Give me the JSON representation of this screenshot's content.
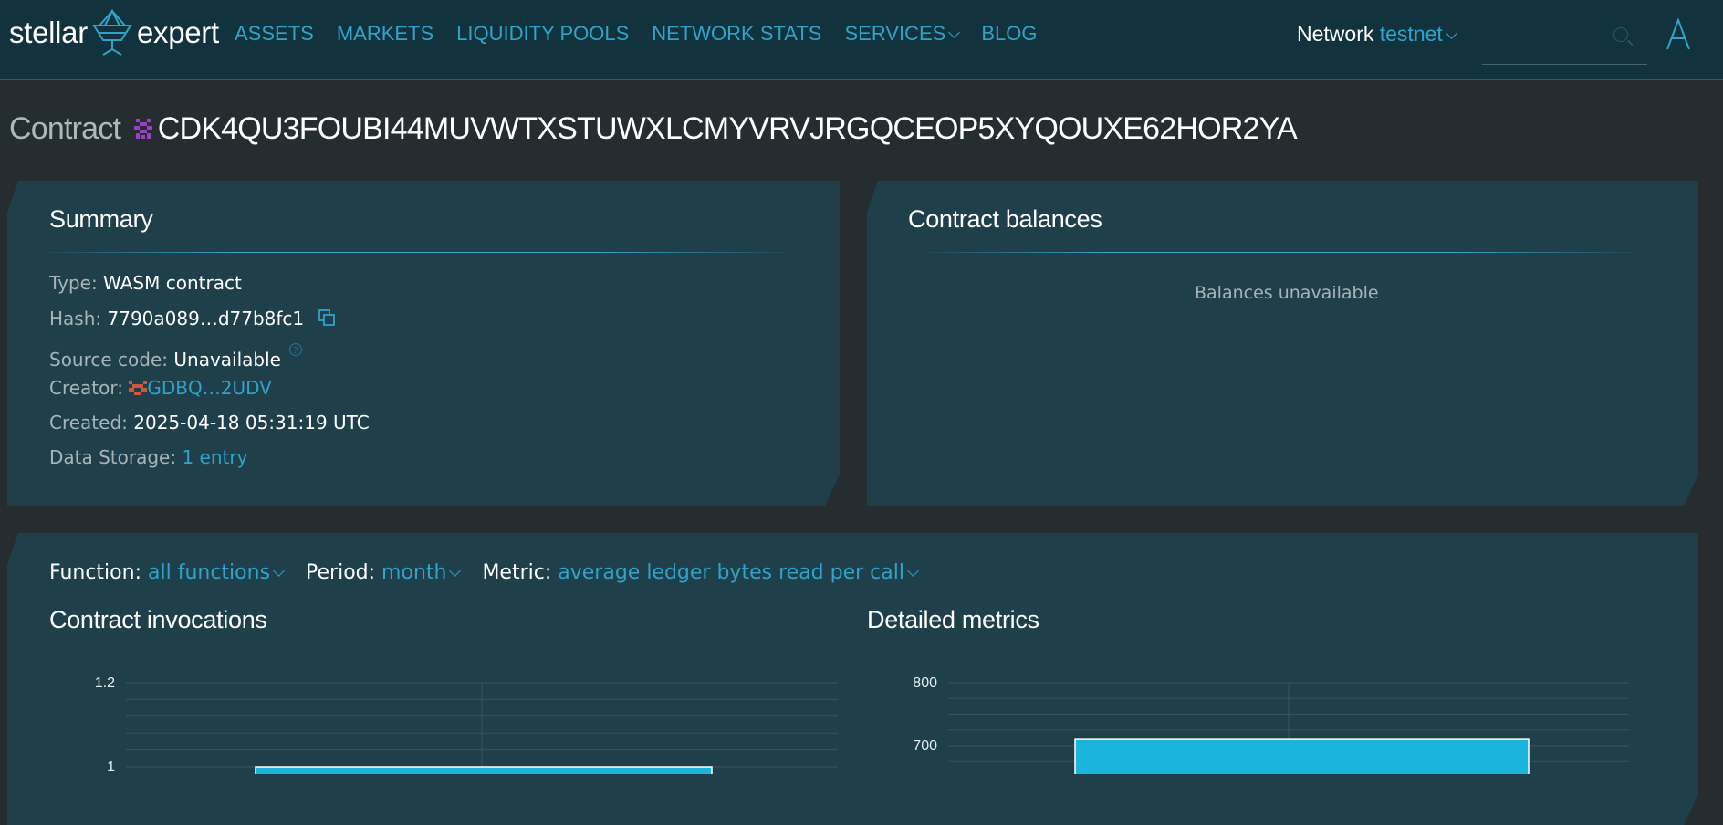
{
  "brand": {
    "left": "stellar",
    "right": "expert"
  },
  "nav": [
    "ASSETS",
    "MARKETS",
    "LIQUIDITY POOLS",
    "NETWORK STATS",
    "SERVICES",
    "BLOG"
  ],
  "network": {
    "label": "Network",
    "value": "testnet"
  },
  "page": {
    "label": "Contract",
    "id": "CDK4QU3FOUBI44MUVWTXSTUWXLCMYVRVJRGQCEOP5XYQOUXE62HOR2YA"
  },
  "summary": {
    "title": "Summary",
    "type": {
      "label": "Type:",
      "value": "WASM contract"
    },
    "hash": {
      "label": "Hash:",
      "value": "7790a089…d77b8fc1"
    },
    "source": {
      "label": "Source code:",
      "value": "Unavailable"
    },
    "creator": {
      "label": "Creator:",
      "value": "GDBQ…2UDV"
    },
    "created": {
      "label": "Created:",
      "value": "2025-04-18 05:31:19 UTC"
    },
    "storage": {
      "label": "Data Storage:",
      "value": "1 entry"
    }
  },
  "balances": {
    "title": "Contract balances",
    "empty": "Balances unavailable"
  },
  "filters": {
    "function": {
      "label": "Function:",
      "value": "all functions"
    },
    "period": {
      "label": "Period:",
      "value": "month"
    },
    "metric": {
      "label": "Metric:",
      "value": "average ledger bytes read per call"
    }
  },
  "colors": {
    "accent": "#2fa3c8",
    "bar": "#1ab4dc",
    "panel": "#1f3f4b"
  },
  "chart_data": [
    {
      "type": "bar",
      "title": "Contract invocations",
      "yticks": [
        "1.2",
        "1"
      ],
      "ylim": [
        0,
        1.2
      ],
      "values": [
        1
      ]
    },
    {
      "type": "bar",
      "title": "Detailed metrics",
      "yticks": [
        "800",
        "700"
      ],
      "ylim": [
        0,
        800
      ],
      "values": [
        710
      ]
    }
  ]
}
